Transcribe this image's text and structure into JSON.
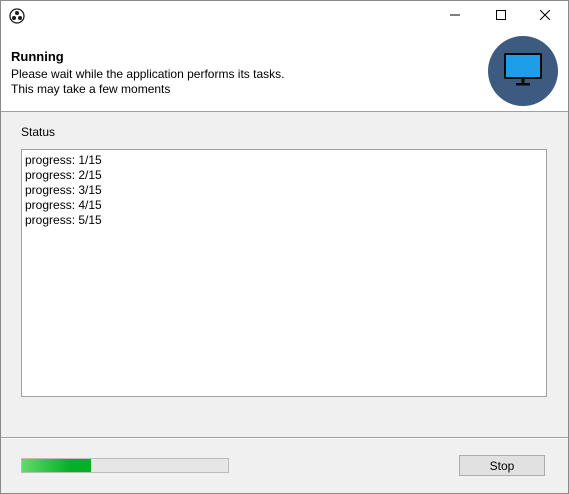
{
  "window": {
    "controls": {
      "minimize_icon": "minimize-icon",
      "maximize_icon": "maximize-icon",
      "close_icon": "close-icon"
    }
  },
  "header": {
    "title": "Running",
    "line1": "Please wait while the application performs its tasks.",
    "line2": "This may take a few moments",
    "graphic_icon": "monitor-icon",
    "graphic_color": "#3d5a80"
  },
  "status": {
    "label": "Status",
    "lines": [
      "progress: 1/15",
      "progress: 2/15",
      "progress: 3/15",
      "progress: 4/15",
      "progress: 5/15"
    ]
  },
  "footer": {
    "progress_fraction": 0.333,
    "progress_color": "#06b025",
    "stop_label": "Stop"
  }
}
